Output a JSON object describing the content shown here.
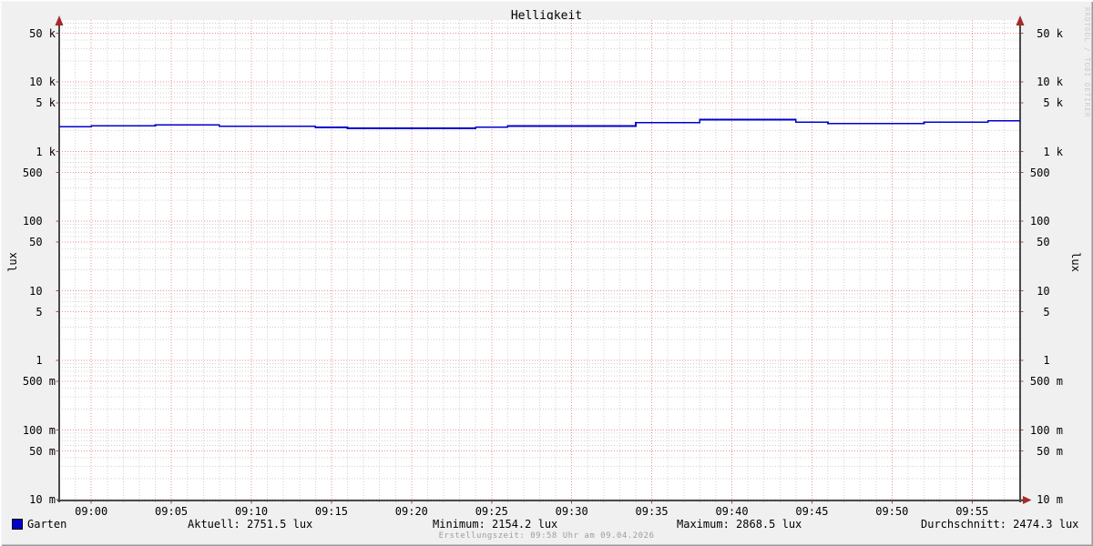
{
  "title": "Helligkeit",
  "watermark": "RRDTOOL / TOBI OETIKER",
  "footer": "Erstellungszeit: 09:58 Uhr am 09.04.2026",
  "y_axis": {
    "unit_left": "lux",
    "unit_right": "lux",
    "scale": "log",
    "labels": [
      {
        "v": 50000,
        "label": "50 k"
      },
      {
        "v": 10000,
        "label": "10 k"
      },
      {
        "v": 5000,
        "label": " 5 k"
      },
      {
        "v": 1000,
        "label": " 1 k"
      },
      {
        "v": 500,
        "label": "500  "
      },
      {
        "v": 100,
        "label": "100  "
      },
      {
        "v": 50,
        "label": " 50  "
      },
      {
        "v": 10,
        "label": " 10  "
      },
      {
        "v": 5,
        "label": "  5  "
      },
      {
        "v": 1,
        "label": "  1  "
      },
      {
        "v": 0.5,
        "label": "500 m"
      },
      {
        "v": 0.1,
        "label": "100 m"
      },
      {
        "v": 0.05,
        "label": " 50 m"
      },
      {
        "v": 0.01,
        "label": " 10 m"
      }
    ]
  },
  "x_axis": {
    "start": "08:58",
    "end": "09:58",
    "major_ticks": [
      "09:00",
      "09:05",
      "09:10",
      "09:15",
      "09:20",
      "09:25",
      "09:30",
      "09:35",
      "09:40",
      "09:45",
      "09:50",
      "09:55"
    ],
    "minor_step_minutes": 1
  },
  "legend": {
    "series_label": "Garten",
    "stats": [
      "Aktuell: 2751.5 lux",
      "Minimum: 2154.2 lux",
      "Maximum: 2868.5 lux",
      "Durchschnitt: 2474.3 lux"
    ]
  },
  "colors": {
    "background": "#f0f0f0",
    "canvas": "#ffffff",
    "grid_minor": "#d2d2d2",
    "grid_major": "#e89090",
    "axis": "#4a4a4a",
    "arrow": "#a52a2a",
    "tick_major": "#c04040",
    "tick_minor": "#8a8a8a",
    "series": "#0000cc"
  },
  "chart_data": {
    "type": "line",
    "title": "Helligkeit",
    "ylabel": "lux",
    "yscale": "log",
    "ylim": [
      0.01,
      75000
    ],
    "x_range": [
      "08:58",
      "09:58"
    ],
    "grid": true,
    "legend_position": "bottom",
    "series": [
      {
        "name": "Garten",
        "color": "#0000cc",
        "style": "steps",
        "steps": [
          {
            "from": "08:58",
            "to": "09:00",
            "value": 2280
          },
          {
            "from": "09:00",
            "to": "09:04",
            "value": 2350
          },
          {
            "from": "09:04",
            "to": "09:08",
            "value": 2410
          },
          {
            "from": "09:08",
            "to": "09:14",
            "value": 2310
          },
          {
            "from": "09:14",
            "to": "09:16",
            "value": 2220
          },
          {
            "from": "09:16",
            "to": "09:24",
            "value": 2154.2
          },
          {
            "from": "09:24",
            "to": "09:26",
            "value": 2250
          },
          {
            "from": "09:26",
            "to": "09:34",
            "value": 2320
          },
          {
            "from": "09:34",
            "to": "09:38",
            "value": 2610
          },
          {
            "from": "09:38",
            "to": "09:44",
            "value": 2868.5
          },
          {
            "from": "09:44",
            "to": "09:46",
            "value": 2640
          },
          {
            "from": "09:46",
            "to": "09:52",
            "value": 2530
          },
          {
            "from": "09:52",
            "to": "09:56",
            "value": 2640
          },
          {
            "from": "09:56",
            "to": "09:58",
            "value": 2751.5
          }
        ]
      }
    ],
    "stats": {
      "current": 2751.5,
      "min": 2154.2,
      "max": 2868.5,
      "avg": 2474.3,
      "unit": "lux"
    }
  }
}
